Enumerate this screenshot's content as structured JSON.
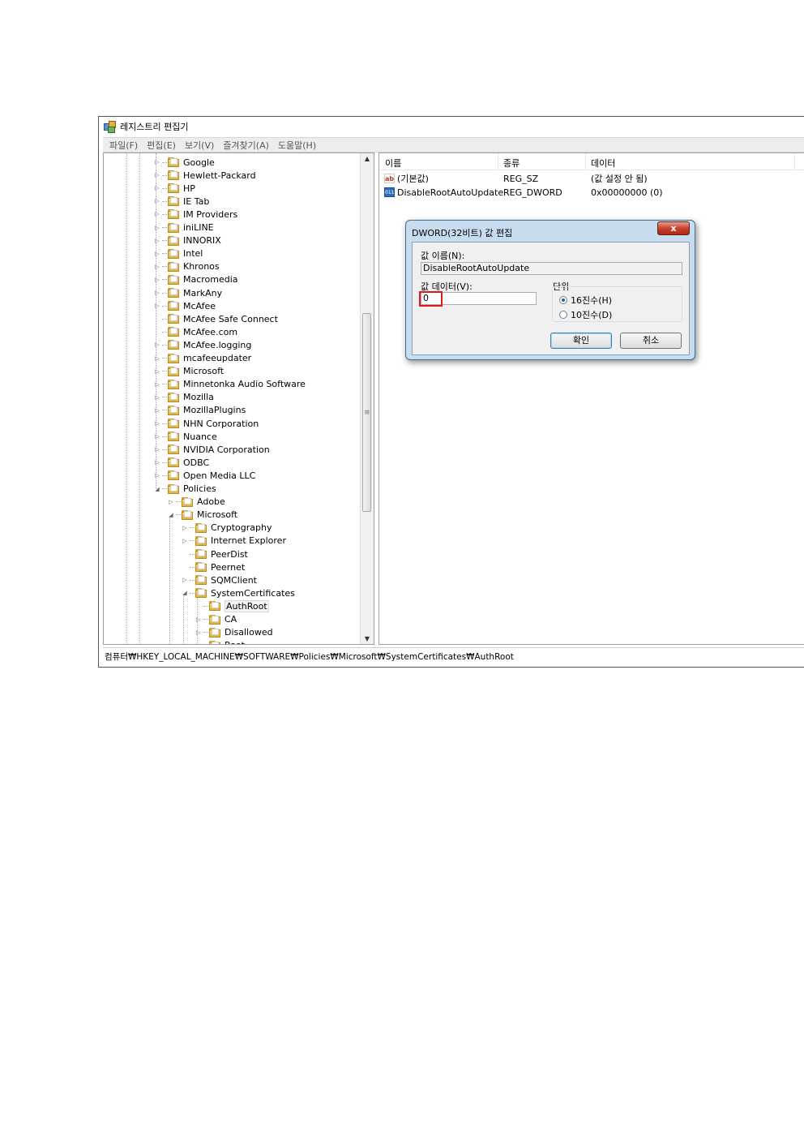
{
  "window": {
    "title": "레지스트리 편집기",
    "menu": [
      "파일(F)",
      "편집(E)",
      "보기(V)",
      "즐겨찾기(A)",
      "도움말(H)"
    ]
  },
  "tree": {
    "items": [
      {
        "label": "Google",
        "level": 0,
        "expander": "▷"
      },
      {
        "label": "Hewlett-Packard",
        "level": 0,
        "expander": "▷"
      },
      {
        "label": "HP",
        "level": 0,
        "expander": "▷"
      },
      {
        "label": "IE Tab",
        "level": 0,
        "expander": "▷"
      },
      {
        "label": "IM Providers",
        "level": 0,
        "expander": "▷"
      },
      {
        "label": "iniLINE",
        "level": 0,
        "expander": "▷"
      },
      {
        "label": "INNORIX",
        "level": 0,
        "expander": "▷"
      },
      {
        "label": "Intel",
        "level": 0,
        "expander": "▷"
      },
      {
        "label": "Khronos",
        "level": 0,
        "expander": "▷"
      },
      {
        "label": "Macromedia",
        "level": 0,
        "expander": "▷"
      },
      {
        "label": "MarkAny",
        "level": 0,
        "expander": "▷"
      },
      {
        "label": "McAfee",
        "level": 0,
        "expander": "▷"
      },
      {
        "label": "McAfee Safe Connect",
        "level": 0,
        "expander": ""
      },
      {
        "label": "McAfee.com",
        "level": 0,
        "expander": ""
      },
      {
        "label": "McAfee.logging",
        "level": 0,
        "expander": "▷"
      },
      {
        "label": "mcafeeupdater",
        "level": 0,
        "expander": "▷"
      },
      {
        "label": "Microsoft",
        "level": 0,
        "expander": "▷"
      },
      {
        "label": "Minnetonka Audio Software",
        "level": 0,
        "expander": "▷"
      },
      {
        "label": "Mozilla",
        "level": 0,
        "expander": "▷"
      },
      {
        "label": "MozillaPlugins",
        "level": 0,
        "expander": "▷"
      },
      {
        "label": "NHN Corporation",
        "level": 0,
        "expander": "▷"
      },
      {
        "label": "Nuance",
        "level": 0,
        "expander": "▷"
      },
      {
        "label": "NVIDIA Corporation",
        "level": 0,
        "expander": "▷"
      },
      {
        "label": "ODBC",
        "level": 0,
        "expander": "▷"
      },
      {
        "label": "Open Media LLC",
        "level": 0,
        "expander": "▷"
      },
      {
        "label": "Policies",
        "level": 0,
        "expander": "◢"
      },
      {
        "label": "Adobe",
        "level": 1,
        "expander": "▷"
      },
      {
        "label": "Microsoft",
        "level": 1,
        "expander": "◢"
      },
      {
        "label": "Cryptography",
        "level": 2,
        "expander": "▷"
      },
      {
        "label": "Internet Explorer",
        "level": 2,
        "expander": "▷"
      },
      {
        "label": "PeerDist",
        "level": 2,
        "expander": ""
      },
      {
        "label": "Peernet",
        "level": 2,
        "expander": ""
      },
      {
        "label": "SQMClient",
        "level": 2,
        "expander": "▷"
      },
      {
        "label": "SystemCertificates",
        "level": 2,
        "expander": "◢"
      },
      {
        "label": "AuthRoot",
        "level": 3,
        "expander": "",
        "selected": true
      },
      {
        "label": "CA",
        "level": 3,
        "expander": "▷"
      },
      {
        "label": "Disallowed",
        "level": 3,
        "expander": "▷"
      },
      {
        "label": "Root",
        "level": 3,
        "expander": "▷"
      }
    ]
  },
  "list": {
    "columns": [
      "이름",
      "종류",
      "데이터"
    ],
    "rows": [
      {
        "icon": "ab",
        "name": "(기본값)",
        "type": "REG_SZ",
        "data": "(값 설정 안 됨)"
      },
      {
        "icon": "011",
        "name": "DisableRootAutoUpdate",
        "type": "REG_DWORD",
        "data": "0x00000000 (0)"
      }
    ]
  },
  "status_path": "컴퓨터₩HKEY_LOCAL_MACHINE₩SOFTWARE₩Policies₩Microsoft₩SystemCertificates₩AuthRoot",
  "dialog": {
    "title": "DWORD(32비트) 값 편집",
    "close_label": "x",
    "value_name_label": "값 이름(N):",
    "value_name": "DisableRootAutoUpdate",
    "value_data_label": "값 데이터(V):",
    "value_data": "0",
    "unit_label": "단위",
    "radio_hex": "16진수(H)",
    "radio_dec": "10진수(D)",
    "ok_label": "확인",
    "cancel_label": "취소"
  },
  "colors": {
    "highlight": "#e01818",
    "folder": "#e0b23a"
  }
}
